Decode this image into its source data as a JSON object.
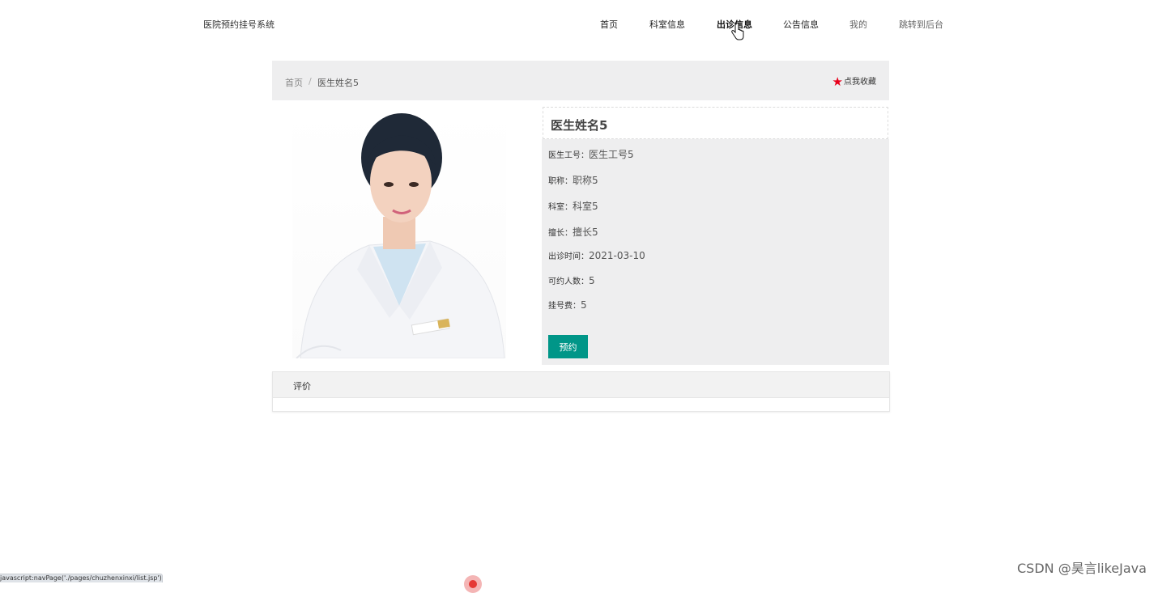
{
  "header": {
    "site_title": "医院预约挂号系统",
    "nav": [
      {
        "label": "首页"
      },
      {
        "label": "科室信息"
      },
      {
        "label": "出诊信息"
      },
      {
        "label": "公告信息"
      },
      {
        "label": "我的"
      },
      {
        "label": "跳转到后台"
      }
    ]
  },
  "breadcrumb": {
    "home": "首页",
    "separator": "/",
    "current": "医生姓名5"
  },
  "favorite": {
    "label": "点我收藏",
    "icon": "star-icon",
    "color": "#e8001b"
  },
  "doctor": {
    "name": "医生姓名5",
    "photo_icon": "doctor-portrait",
    "fields": [
      {
        "label": "医生工号：",
        "value": "医生工号5"
      },
      {
        "label": "职称：",
        "value": "职称5"
      },
      {
        "label": "科室：",
        "value": "科室5"
      },
      {
        "label": "擅长：",
        "value": "擅长5"
      },
      {
        "label": "出诊时间：",
        "value": "2021-03-10"
      },
      {
        "label": "可约人数：",
        "value": "5"
      },
      {
        "label": "挂号费：",
        "value": "5"
      }
    ],
    "book_button": "预约"
  },
  "comments": {
    "title": "评价"
  },
  "status": {
    "url": "javascript:navPage('./pages/chuzhenxinxi/list.jsp')"
  },
  "watermark": "CSDN @昊言likeJava",
  "colors": {
    "accent": "#009688",
    "star": "#e8001b",
    "panel_bg": "#eeeeef"
  }
}
